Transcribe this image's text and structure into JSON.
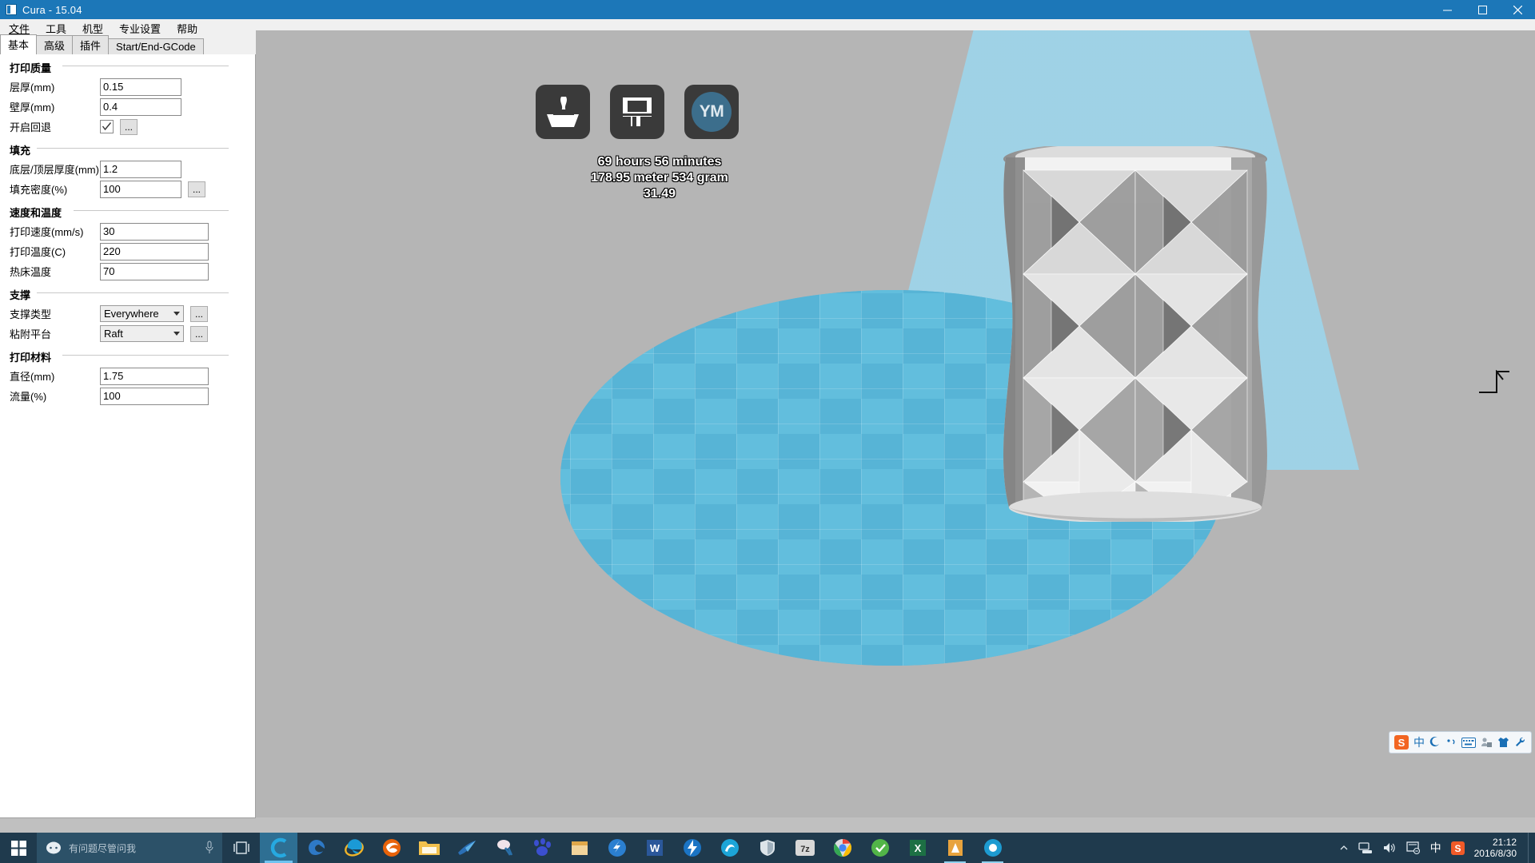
{
  "window": {
    "title": "Cura - 15.04",
    "icon": "cura-app-icon",
    "minimize_label": "─",
    "maximize_label": "□",
    "close_label": "✕"
  },
  "menu": {
    "items": [
      {
        "label": "文件",
        "name": "menu-file"
      },
      {
        "label": "工具",
        "name": "menu-tools"
      },
      {
        "label": "机型",
        "name": "menu-machine"
      },
      {
        "label": "专业设置",
        "name": "menu-expert"
      },
      {
        "label": "帮助",
        "name": "menu-help"
      }
    ]
  },
  "tabs": {
    "items": [
      {
        "label": "基本",
        "name": "tab-basic",
        "active": true
      },
      {
        "label": "高级",
        "name": "tab-advanced",
        "active": false
      },
      {
        "label": "插件",
        "name": "tab-plugins",
        "active": false
      },
      {
        "label": "Start/End-GCode",
        "name": "tab-gcode",
        "active": false
      }
    ]
  },
  "settings": {
    "quality": {
      "title": "打印质量",
      "layer_height_label": "层厚(mm)",
      "layer_height_value": "0.15",
      "shell_thickness_label": "壁厚(mm)",
      "shell_thickness_value": "0.4",
      "retraction_label": "开启回退",
      "retraction_checked": true,
      "dots_label": "..."
    },
    "fill": {
      "title": "填充",
      "bottom_top_label": "底层/顶层厚度(mm)",
      "bottom_top_value": "1.2",
      "density_label": "填充密度(%)",
      "density_value": "100",
      "dots_label": "..."
    },
    "speed": {
      "title": "速度和温度",
      "print_speed_label": "打印速度(mm/s)",
      "print_speed_value": "30",
      "print_temp_label": "打印温度(C)",
      "print_temp_value": "220",
      "bed_temp_label": "热床温度",
      "bed_temp_value": "70"
    },
    "support": {
      "title": "支撑",
      "support_type_label": "支撑类型",
      "support_type_value": "Everywhere",
      "platform_adhesion_label": "粘附平台",
      "platform_adhesion_value": "Raft",
      "dots_label": "..."
    },
    "material": {
      "title": "打印材料",
      "diameter_label": "直径(mm)",
      "diameter_value": "1.75",
      "flow_label": "流量(%)",
      "flow_value": "100"
    }
  },
  "viewport": {
    "toolbar": {
      "load_name": "load-model-button",
      "save_name": "save-toolpath-button",
      "ym_name": "ym-account-button",
      "ym_label": "YM",
      "view_mode_name": "view-mode-button"
    },
    "info": {
      "time": "69 hours 56 minutes",
      "material": "178.95 meter 534 gram",
      "cost": "31.49"
    }
  },
  "ime": {
    "logo_label": "S",
    "mode_label": "中",
    "icons": [
      "sogou-logo-icon",
      "chinese-mode-icon",
      "moon-icon",
      "punctuation-icon",
      "keyboard-icon",
      "user-icon",
      "skin-icon",
      "toolbox-icon"
    ]
  },
  "taskbar": {
    "start_name": "start-button",
    "cortana_placeholder": "有问题尽管问我",
    "task_view_name": "task-view-button",
    "apps": [
      {
        "name": "taskbar-app-cura-blue",
        "label": "C"
      },
      {
        "name": "taskbar-app-edge",
        "label": "e"
      },
      {
        "name": "taskbar-app-ie",
        "label": "e"
      },
      {
        "name": "taskbar-app-firefox",
        "label": ""
      },
      {
        "name": "taskbar-app-explorer",
        "label": ""
      },
      {
        "name": "taskbar-app-foxmail",
        "label": ""
      },
      {
        "name": "taskbar-app-bandizip",
        "label": ""
      },
      {
        "name": "taskbar-app-baidu",
        "label": ""
      },
      {
        "name": "taskbar-app-store",
        "label": ""
      },
      {
        "name": "taskbar-app-thunder",
        "label": ""
      },
      {
        "name": "taskbar-app-word",
        "label": ""
      },
      {
        "name": "taskbar-app-bolt",
        "label": ""
      },
      {
        "name": "taskbar-app-design",
        "label": ""
      },
      {
        "name": "taskbar-app-shield",
        "label": ""
      },
      {
        "name": "taskbar-app-7z",
        "label": "7z"
      },
      {
        "name": "taskbar-app-chrome",
        "label": ""
      },
      {
        "name": "taskbar-app-green",
        "label": ""
      },
      {
        "name": "taskbar-app-excel",
        "label": ""
      },
      {
        "name": "taskbar-app-cura",
        "label": ""
      },
      {
        "name": "taskbar-app-photo",
        "label": ""
      }
    ],
    "tray": {
      "chevron": "∧",
      "network_icon": "network-icon",
      "volume_icon": "volume-icon",
      "action_center_icon": "action-center-icon",
      "ime_label": "中",
      "sogou_label": "S",
      "time": "21:12",
      "date": "2016/8/30"
    }
  }
}
